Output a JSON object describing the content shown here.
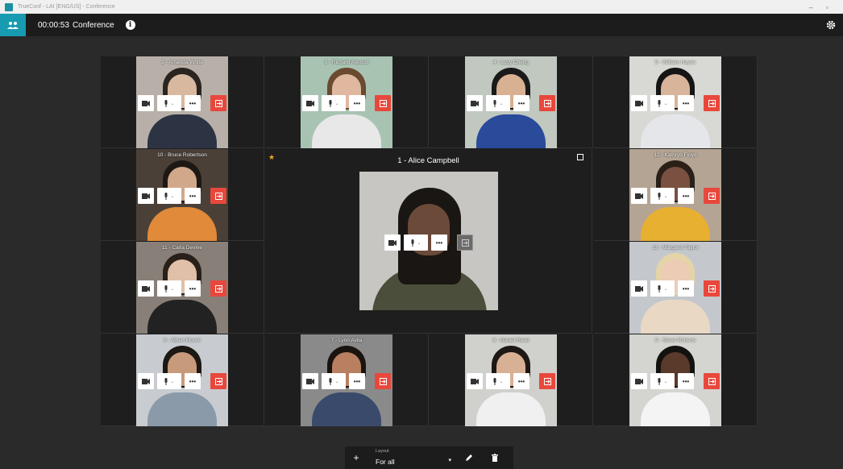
{
  "window": {
    "title": "TrueConf - LAI [ENG/US] - Conference"
  },
  "topbar": {
    "elapsed": "00:00:53",
    "title": "Conference",
    "info_icon": "info-icon"
  },
  "main_speaker": {
    "name": "1 - Alice Campbell",
    "hair": "#1a1614",
    "face": "#6b4a3a",
    "body": "#4a4e3a",
    "bg": "#c8c6c2"
  },
  "participants": [
    {
      "name": "2 - Amanda White",
      "bg": "#b8b0a8",
      "hair": "#2a2420",
      "face": "#d9b8a0",
      "body": "#2c3444"
    },
    {
      "name": "3 - Richard Atwood",
      "bg": "#a9c3b2",
      "hair": "#6a4a30",
      "face": "#e0b8a0",
      "body": "#e8e8e8"
    },
    {
      "name": "4 - Lucy Cheng",
      "bg": "#c0c8c0",
      "hair": "#1a1a1a",
      "face": "#d8b092",
      "body": "#2a4a9a"
    },
    {
      "name": "5 - William Hayes",
      "bg": "#d8d8d4",
      "hair": "#151515",
      "face": "#d8b49a",
      "body": "#e4e6ea"
    },
    {
      "name": "10 - Bruce Robertson",
      "bg": "#4a4038",
      "hair": "#1e1814",
      "face": "#d2a88a",
      "body": "#e08a3a"
    },
    {
      "name": "12 - Kathryn Floyd",
      "bg": "#b4a494",
      "hair": "#2a2018",
      "face": "#7a5040",
      "body": "#e8b030"
    },
    {
      "name": "11 - Carla Devine",
      "bg": "#888078",
      "hair": "#2a201a",
      "face": "#e0c0a8",
      "body": "#222222"
    },
    {
      "name": "13 - Margaret Taylor",
      "bg": "#c4c8cc",
      "hair": "#e4d4a8",
      "face": "#ecccb4",
      "body": "#e8d8c4"
    },
    {
      "name": "6 - Albert Moore",
      "bg": "#c8ccd0",
      "hair": "#1c1814",
      "face": "#c89a7c",
      "body": "#8a9aa8"
    },
    {
      "name": "7 - Lynn Avila",
      "bg": "#8a8a8a",
      "hair": "#1a1410",
      "face": "#b88060",
      "body": "#3a4a6a"
    },
    {
      "name": "8 - Daniel Reed",
      "bg": "#d0d0cc",
      "hair": "#1e1814",
      "face": "#d8b094",
      "body": "#f0f0f0"
    },
    {
      "name": "9 - Steve Roberts",
      "bg": "#d4d4d0",
      "hair": "#141210",
      "face": "#5a3a2a",
      "body": "#f4f4f4"
    }
  ],
  "controls": {
    "more_label": "•••",
    "mic_chevron": "⌄"
  },
  "bottombar": {
    "plus_label": "+",
    "layout_label": "Layout",
    "layout_value": "For all",
    "dropdown_arrow": "▾"
  }
}
